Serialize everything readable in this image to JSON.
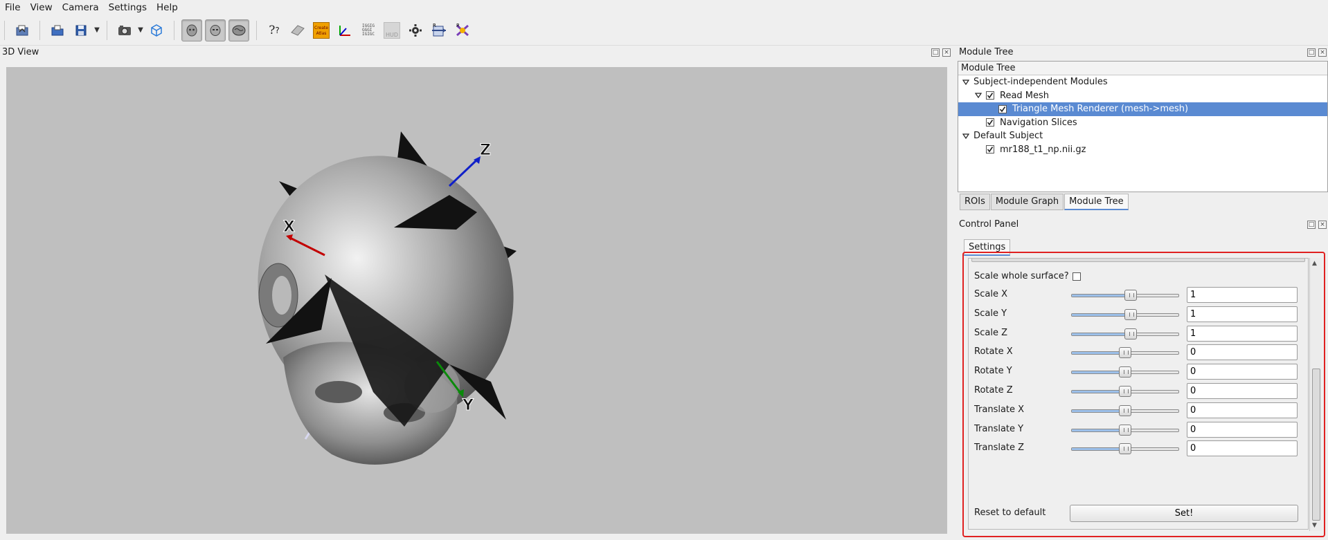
{
  "menu": [
    "File",
    "View",
    "Camera",
    "Settings",
    "Help"
  ],
  "toolbar": {
    "icons": [
      "open-folder-icon",
      "open-file-icon",
      "save-icon",
      "screenshot-icon",
      "cube-icon",
      "head-3d-icon",
      "head-front-icon",
      "brain-side-icon",
      "help-icon",
      "slice-icon",
      "create-atlas-icon",
      "axes-icon",
      "labels-icon",
      "hud-icon",
      "gear-icon",
      "reorient-icon",
      "transform-icon"
    ],
    "create_atlas_label": "Create Atlas",
    "hud_label": "HUD"
  },
  "view3d": {
    "title": "3D View",
    "axis_x": "X",
    "axis_y": "Y",
    "axis_z": "Z",
    "background": "#bfbfbf"
  },
  "module_tree": {
    "dock_title": "Module Tree",
    "header": "Module Tree",
    "items": [
      {
        "label": "Subject-independent Modules",
        "level": 0,
        "expander": true,
        "checkbox": false
      },
      {
        "label": "Read Mesh",
        "level": 1,
        "expander": true,
        "checkbox": true,
        "checked": true
      },
      {
        "label": "Triangle Mesh Renderer (mesh->mesh)",
        "level": 2,
        "expander": false,
        "checkbox": true,
        "checked": true,
        "selected": true
      },
      {
        "label": "Navigation Slices",
        "level": 1,
        "expander": false,
        "checkbox": true,
        "checked": true
      },
      {
        "label": "Default Subject",
        "level": 0,
        "expander": true,
        "checkbox": false
      },
      {
        "label": "mr188_t1_np.nii.gz",
        "level": 1,
        "expander": false,
        "checkbox": true,
        "checked": true
      }
    ],
    "tabs": [
      "ROIs",
      "Module Graph",
      "Module Tree"
    ],
    "active_tab": "Module Tree"
  },
  "control_panel": {
    "dock_title": "Control Panel",
    "tab": "Settings",
    "scale_whole_label": "Scale whole surface?",
    "scale_whole_checked": false,
    "rows": [
      {
        "label": "Scale X",
        "value": "1",
        "slider": 0.55
      },
      {
        "label": "Scale Y",
        "value": "1",
        "slider": 0.55
      },
      {
        "label": "Scale Z",
        "value": "1",
        "slider": 0.55
      },
      {
        "label": "Rotate X",
        "value": "0",
        "slider": 0.5
      },
      {
        "label": "Rotate Y",
        "value": "0",
        "slider": 0.5
      },
      {
        "label": "Rotate Z",
        "value": "0",
        "slider": 0.5
      },
      {
        "label": "Translate X",
        "value": "0",
        "slider": 0.5
      },
      {
        "label": "Translate Y",
        "value": "0",
        "slider": 0.5
      },
      {
        "label": "Translate Z",
        "value": "0",
        "slider": 0.5
      }
    ],
    "reset_label": "Reset to default",
    "set_button": "Set!",
    "highlight_color": "#e02020"
  },
  "colors": {
    "selection": "#5a8ad2",
    "slider_fill": "#9cc0ea"
  }
}
